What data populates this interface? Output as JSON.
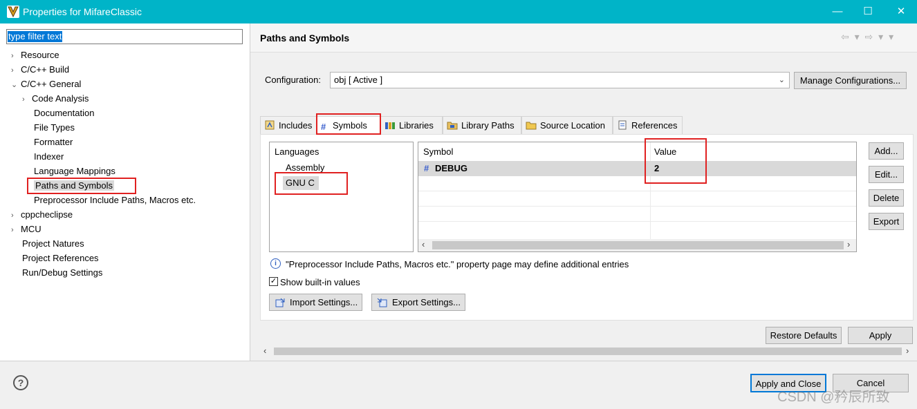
{
  "window": {
    "title": "Properties for MifareClassic",
    "minimize": "—",
    "maximize": "☐",
    "close": "✕"
  },
  "filter": {
    "placeholder": "type filter text"
  },
  "tree": [
    {
      "label": "Resource",
      "arrow": "›"
    },
    {
      "label": "C/C++ Build",
      "arrow": "›"
    },
    {
      "label": "C/C++ General",
      "arrow": "⌄"
    },
    {
      "label": "Code Analysis",
      "arrow": "›"
    },
    {
      "label": "Documentation"
    },
    {
      "label": "File Types"
    },
    {
      "label": "Formatter"
    },
    {
      "label": "Indexer"
    },
    {
      "label": "Language Mappings"
    },
    {
      "label": "Paths and Symbols"
    },
    {
      "label": "Preprocessor Include Paths, Macros etc."
    },
    {
      "label": "cppcheclipse",
      "arrow": "›"
    },
    {
      "label": "MCU",
      "arrow": "›"
    },
    {
      "label": "Project Natures"
    },
    {
      "label": "Project References"
    },
    {
      "label": "Run/Debug Settings"
    }
  ],
  "page": {
    "title": "Paths and Symbols",
    "nav_icons": "⇦ ▾ ⇨ ▾ ▾"
  },
  "configuration": {
    "label": "Configuration:",
    "value": "obj  [ Active ]",
    "manage_label": "Manage Configurations..."
  },
  "tabs": [
    {
      "label": "Includes",
      "icon": "includes-icon"
    },
    {
      "label": "Symbols",
      "icon": "hash-icon"
    },
    {
      "label": "Libraries",
      "icon": "libraries-icon"
    },
    {
      "label": "Library Paths",
      "icon": "library-paths-icon"
    },
    {
      "label": "Source Location",
      "icon": "folder-icon"
    },
    {
      "label": "References",
      "icon": "references-icon"
    }
  ],
  "languages": {
    "header": "Languages",
    "items": [
      "Assembly",
      "GNU C"
    ]
  },
  "symbols": {
    "headers": [
      "Symbol",
      "Value"
    ],
    "rows": [
      {
        "symbol": "DEBUG",
        "value": "2"
      }
    ]
  },
  "side_buttons": {
    "add": "Add...",
    "edit": "Edit...",
    "delete": "Delete",
    "export": "Export"
  },
  "info_text": "\"Preprocessor Include Paths, Macros etc.\" property page may define additional entries",
  "show_builtin": {
    "label": "Show built-in values",
    "checked": true
  },
  "import_label": "Import Settings...",
  "export_label": "Export Settings...",
  "restore_label": "Restore Defaults",
  "apply_label": "Apply",
  "apply_close_label": "Apply and Close",
  "cancel_label": "Cancel",
  "help_icon_text": "?",
  "watermark": "CSDN @矜辰所致",
  "colors": {
    "titlebar": "#00b4c8",
    "highlight": "#e02020",
    "selection": "#0078d7"
  }
}
